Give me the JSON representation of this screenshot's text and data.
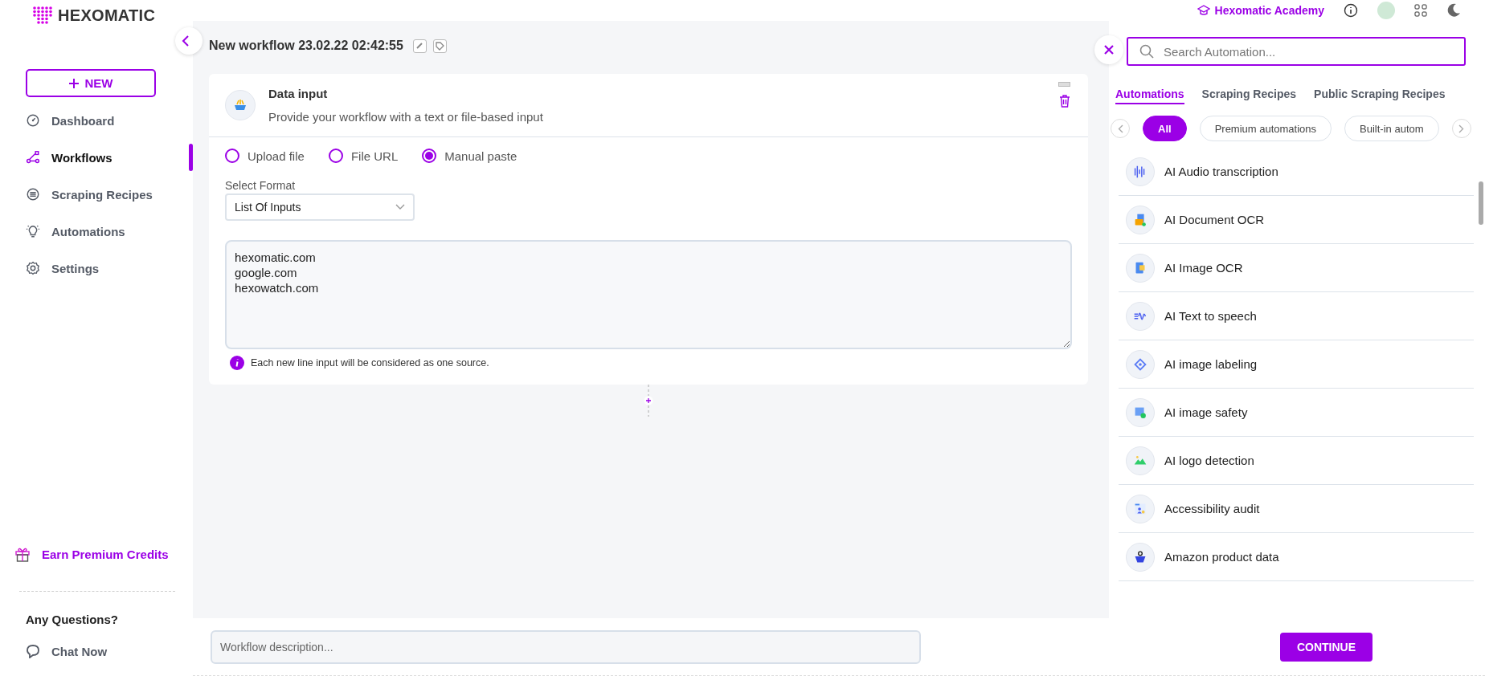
{
  "logo": {
    "text": "HEXOMATIC"
  },
  "sidebar": {
    "new_button": "NEW",
    "items": [
      {
        "label": "Dashboard",
        "selected": false
      },
      {
        "label": "Workflows",
        "selected": true
      },
      {
        "label": "Scraping Recipes",
        "selected": false
      },
      {
        "label": "Automations",
        "selected": false
      },
      {
        "label": "Settings",
        "selected": false
      }
    ],
    "earn_credits": "Earn Premium Credits",
    "questions_heading": "Any Questions?",
    "chat_now": "Chat Now"
  },
  "header": {
    "academy_link": "Hexomatic Academy"
  },
  "workflow": {
    "title": "New workflow 23.02.22 02:42:55",
    "step": {
      "title": "Data input",
      "description": "Provide your workflow with a text or file-based input",
      "source_options": [
        {
          "label": "Upload file",
          "selected": false
        },
        {
          "label": "File URL",
          "selected": false
        },
        {
          "label": "Manual paste",
          "selected": true
        }
      ],
      "format_label": "Select Format",
      "format_value": "List Of Inputs",
      "inputs": "hexomatic.com\ngoogle.com\nhexowatch.com",
      "hint": "Each new line input will be considered as one source."
    }
  },
  "automation_panel": {
    "search_placeholder": "Search Automation...",
    "tabs": [
      {
        "label": "Automations",
        "selected": true
      },
      {
        "label": "Scraping Recipes",
        "selected": false
      },
      {
        "label": "Public Scraping Recipes",
        "selected": false
      }
    ],
    "filters": [
      {
        "label": "All",
        "selected": true
      },
      {
        "label": "Premium automations",
        "selected": false
      },
      {
        "label": "Built-in autom",
        "selected": false
      }
    ],
    "items": [
      {
        "name": "AI Audio transcription"
      },
      {
        "name": "AI Document OCR"
      },
      {
        "name": "AI Image OCR"
      },
      {
        "name": "AI Text to speech"
      },
      {
        "name": "AI image labeling"
      },
      {
        "name": "AI image safety"
      },
      {
        "name": "AI logo detection"
      },
      {
        "name": "Accessibility audit"
      },
      {
        "name": "Amazon product data"
      }
    ]
  },
  "footer": {
    "description_placeholder": "Workflow description...",
    "continue_button": "CONTINUE"
  }
}
